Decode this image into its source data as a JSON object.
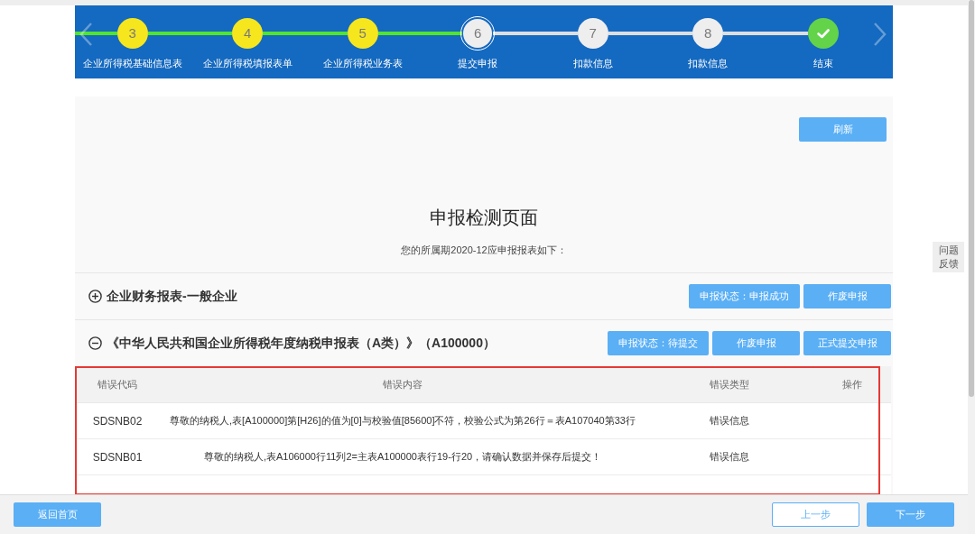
{
  "stepper": {
    "steps": [
      {
        "kind": "number",
        "number": "3",
        "label": "企业所得税基础信息表",
        "completed": true,
        "current": false
      },
      {
        "kind": "number",
        "number": "4",
        "label": "企业所得税填报表单",
        "completed": true,
        "current": false
      },
      {
        "kind": "number",
        "number": "5",
        "label": "企业所得税业务表",
        "completed": true,
        "current": false
      },
      {
        "kind": "number",
        "number": "6",
        "label": "提交申报",
        "completed": false,
        "current": true
      },
      {
        "kind": "number",
        "number": "7",
        "label": "扣款信息",
        "completed": false,
        "current": false
      },
      {
        "kind": "number",
        "number": "8",
        "label": "扣款信息",
        "completed": false,
        "current": false
      },
      {
        "kind": "finish",
        "label": "结束",
        "completed": false,
        "current": false
      }
    ]
  },
  "panel": {
    "refresh_button": "刷新",
    "title": "申报检测页面",
    "subtitle": "您的所属期2020-12应申报报表如下："
  },
  "reports": [
    {
      "name": "企业财务报表-一般企业",
      "expanded": false,
      "buttons": [
        "申报状态：申报成功",
        "作废申报"
      ]
    },
    {
      "name": "《中华人民共和国企业所得税年度纳税申报表（A类）》（A100000）",
      "expanded": true,
      "buttons": [
        "申报状态：待提交",
        "作废申报",
        "正式提交申报"
      ],
      "error_table": {
        "columns": [
          "错误代码",
          "错误内容",
          "错误类型",
          "操作"
        ],
        "rows": [
          {
            "code": "SDSNB02",
            "content": "尊敬的纳税人,表[A100000]第[H26]的值为[0]与校验值[85600]不符，校验公式为第26行＝表A107040第33行",
            "type": "错误信息"
          },
          {
            "code": "SDSNB01",
            "content": "尊敬的纳税人,表A106000行11列2=主表A100000表行19-行20，请确认数据并保存后提交！",
            "type": "错误信息"
          }
        ]
      }
    }
  ],
  "feedback_button": "问题反馈",
  "footer": {
    "left_buttons": [
      {
        "label": "返回首页",
        "kind": "primary"
      }
    ],
    "right_buttons": [
      {
        "label": "上一步",
        "kind": "outline"
      },
      {
        "label": "下一步",
        "kind": "primary"
      }
    ]
  }
}
